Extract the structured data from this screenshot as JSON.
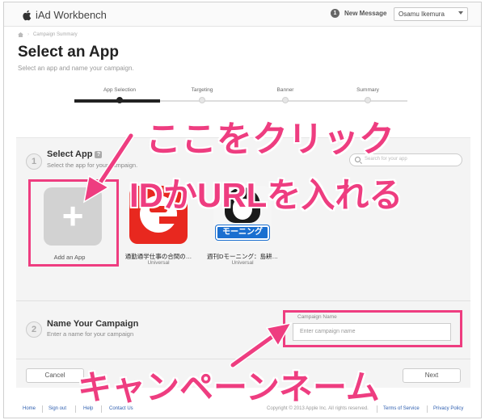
{
  "app": {
    "title": "iAd Workbench"
  },
  "header": {
    "notification_count": "1",
    "notification_label": "New Message",
    "user_name": "Osamu Ikemura"
  },
  "breadcrumb": {
    "current": "Campaign Summary"
  },
  "page": {
    "title": "Select an App",
    "subtitle": "Select an app and name your campaign."
  },
  "stepper": {
    "steps": [
      "App Selection",
      "Targeting",
      "Banner",
      "Summary"
    ],
    "current_index": 0
  },
  "section1": {
    "number": "1",
    "title": "Select App",
    "help": "?",
    "subtitle": "Select the app for your campaign.",
    "search_placeholder": "Search for your app"
  },
  "apps": [
    {
      "name": "Add an App"
    },
    {
      "name": "通勤通学仕事の合間の…",
      "type": "Universal",
      "icon": "red-e-app-icon",
      "color": "#e8281f"
    },
    {
      "name": "週刊Dモーニング：島耕…",
      "type": "Universal",
      "icon": "manga-app-icon",
      "logo_text": "モーニング",
      "color": "#1a6fd0"
    }
  ],
  "section2": {
    "number": "2",
    "title": "Name Your Campaign",
    "subtitle": "Enter a name for your campaign"
  },
  "campaign_field": {
    "label": "Campaign Name",
    "placeholder": "Enter campaign name"
  },
  "buttons": {
    "cancel": "Cancel",
    "next": "Next"
  },
  "footer": {
    "links": [
      "Home",
      "Sign out",
      "Help",
      "Contact Us"
    ],
    "copyright": "Copyright © 2013 Apple Inc. All rights reserved.",
    "terms": "Terms of Service",
    "privacy": "Privacy Policy"
  },
  "annotations": {
    "click_here": "ここをクリック",
    "enter_id_url": "IDかURLを入れる",
    "campaign_name": "キャンペーンネーム",
    "color": "#ee3d80"
  }
}
